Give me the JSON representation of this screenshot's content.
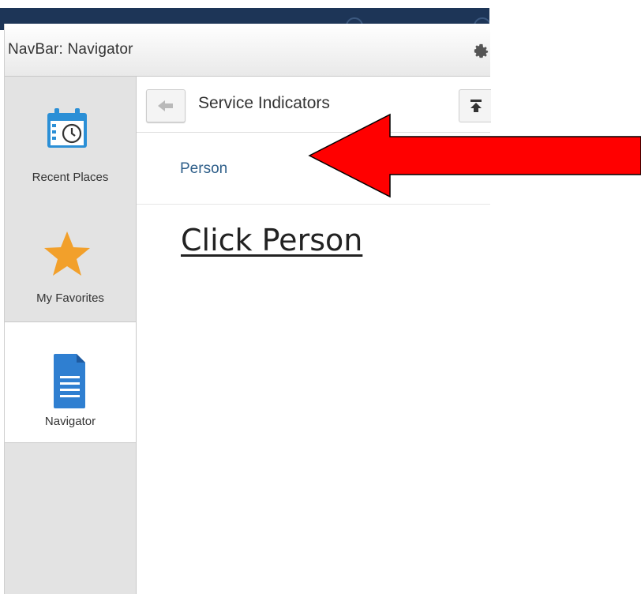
{
  "panel": {
    "title": "NavBar: Navigator",
    "icons": {
      "settings": "gear-icon"
    }
  },
  "sidebar": {
    "items": [
      {
        "label": "Recent Places",
        "icon": "calendar-clock-icon",
        "active": false
      },
      {
        "label": "My Favorites",
        "icon": "star-icon",
        "active": false
      },
      {
        "label": "Navigator",
        "icon": "document-icon",
        "active": true
      }
    ]
  },
  "main": {
    "header": {
      "title": "Service Indicators",
      "back_icon": "back-arrow-icon",
      "top_icon": "scroll-top-icon"
    },
    "links": [
      {
        "label": "Person"
      }
    ]
  },
  "annotation": {
    "text": "Click Person",
    "arrow_icon": "red-arrow-pointer"
  },
  "colors": {
    "topbar": "#1d3557",
    "link": "#2f5f8a",
    "star": "#f2a02b",
    "calendar": "#2b8fd6",
    "document": "#2f7fd1",
    "arrow": "#ff0000"
  }
}
